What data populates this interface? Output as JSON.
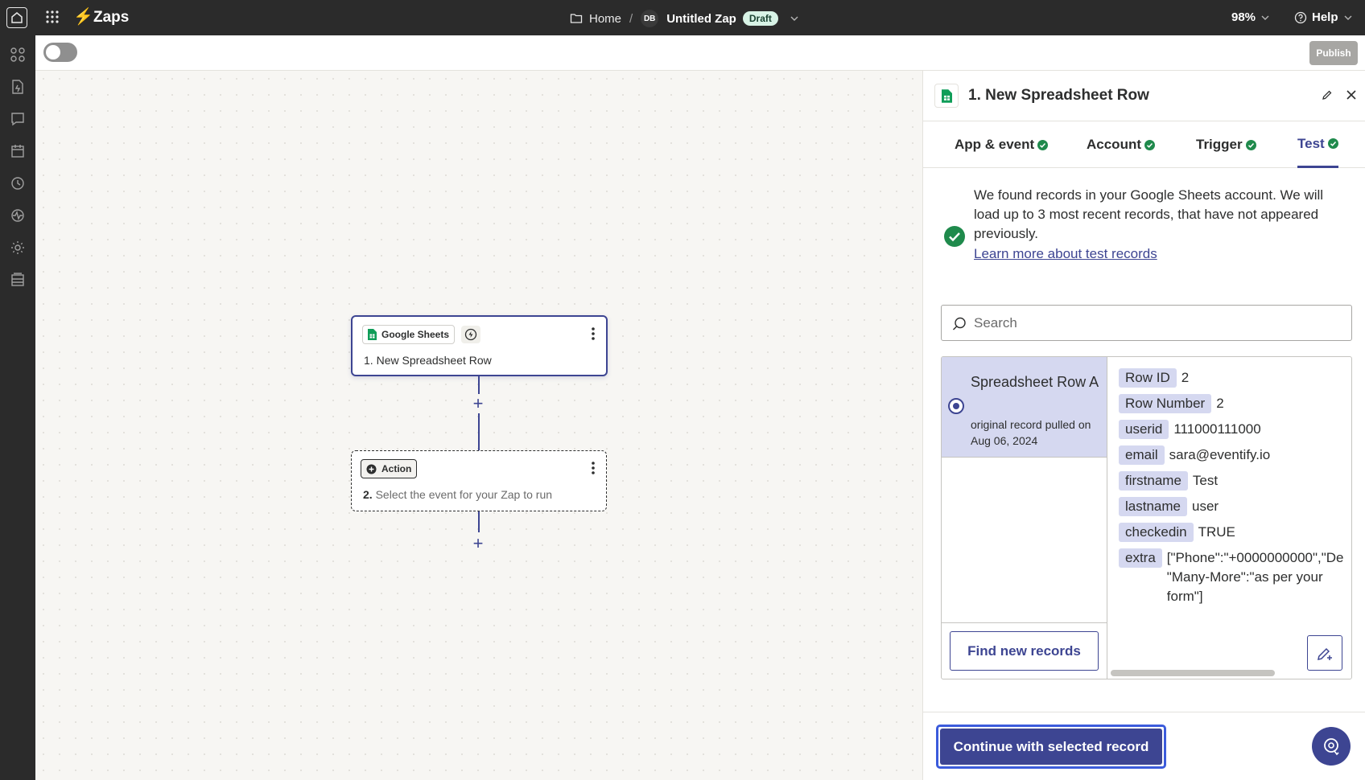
{
  "topbar": {
    "app_title": "Zaps",
    "breadcrumb_home": "Home",
    "breadcrumb_sep": "/",
    "avatar_initials": "DB",
    "zap_name": "Untitled Zap",
    "status_badge": "Draft",
    "zoom": "98%",
    "help_label": "Help"
  },
  "toolbar": {
    "publish_label": "Publish",
    "toggle_on": false
  },
  "canvas": {
    "trigger_node": {
      "app_name": "Google Sheets",
      "title_num": "1.",
      "title": "New Spreadsheet Row"
    },
    "action_node": {
      "chip_label": "Action",
      "title_num": "2.",
      "title": "Select the event for your Zap to run"
    }
  },
  "panel": {
    "title": "1. New Spreadsheet Row",
    "tabs": [
      {
        "label": "App & event",
        "complete": true
      },
      {
        "label": "Account",
        "complete": true
      },
      {
        "label": "Trigger",
        "complete": true
      },
      {
        "label": "Test",
        "complete": true,
        "active": true
      }
    ],
    "notice": {
      "message": "We found records in your Google Sheets account. We will load up to 3 most recent records, that have not appeared previously.",
      "link": "Learn more about test records"
    },
    "search_placeholder": "Search",
    "records": [
      {
        "name": "Spreadsheet Row A",
        "subtitle": "original record pulled on Aug 06, 2024",
        "selected": true
      }
    ],
    "selected_record_fields": [
      {
        "key": "Row ID",
        "value": "2"
      },
      {
        "key": "Row Number",
        "value": "2"
      },
      {
        "key": "userid",
        "value": "111000111000"
      },
      {
        "key": "email",
        "value": "sara@eventify.io"
      },
      {
        "key": "firstname",
        "value": "Test"
      },
      {
        "key": "lastname",
        "value": "user"
      },
      {
        "key": "checkedin",
        "value": "TRUE"
      },
      {
        "key": "extra",
        "value": "[\"Phone\":\"+0000000000\",\"De \"Many-More\":\"as per your form\"]"
      }
    ],
    "find_new_records_label": "Find new records",
    "continue_label": "Continue with selected record"
  },
  "colors": {
    "accent": "#3d4592",
    "brand_orange": "#ff4f00",
    "success": "#1f8a4c",
    "selected_row": "#d5d8f0",
    "topbar": "#2b2b2b"
  }
}
